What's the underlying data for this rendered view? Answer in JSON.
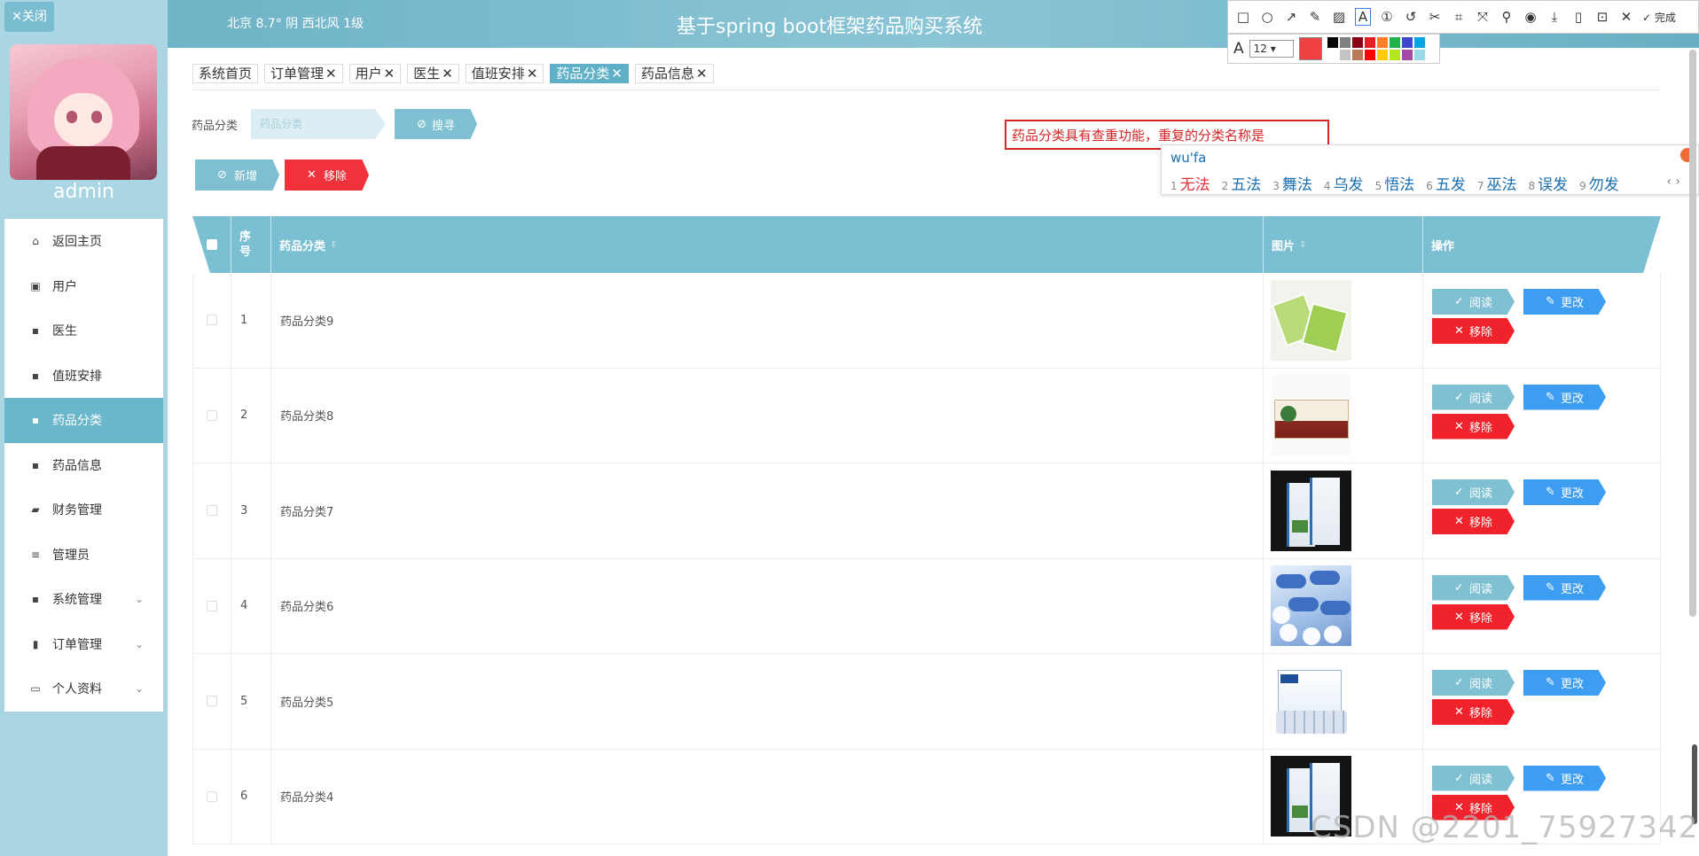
{
  "sidebar": {
    "close_label": "✕关闭",
    "username": "admin",
    "menu": [
      {
        "label": "返回主页",
        "icon": "home-icon",
        "glyph": "⌂",
        "active": false,
        "expandable": false
      },
      {
        "label": "用户",
        "icon": "user-icon",
        "glyph": "▣",
        "active": false,
        "expandable": false
      },
      {
        "label": "医生",
        "icon": "grid-icon",
        "glyph": "▪",
        "active": false,
        "expandable": false
      },
      {
        "label": "值班安排",
        "icon": "grid-icon",
        "glyph": "▪",
        "active": false,
        "expandable": false
      },
      {
        "label": "药品分类",
        "icon": "grid-icon",
        "glyph": "▪",
        "active": true,
        "expandable": false
      },
      {
        "label": "药品信息",
        "icon": "grid-icon",
        "glyph": "▪",
        "active": false,
        "expandable": false
      },
      {
        "label": "财务管理",
        "icon": "wallet-icon",
        "glyph": "▰",
        "active": false,
        "expandable": false
      },
      {
        "label": "管理员",
        "icon": "list-icon",
        "glyph": "≡",
        "active": false,
        "expandable": false
      },
      {
        "label": "系统管理",
        "icon": "grid-icon",
        "glyph": "▪",
        "active": false,
        "expandable": true
      },
      {
        "label": "订单管理",
        "icon": "chart-icon",
        "glyph": "▮",
        "active": false,
        "expandable": true
      },
      {
        "label": "个人资料",
        "icon": "card-icon",
        "glyph": "▭",
        "active": false,
        "expandable": true
      }
    ]
  },
  "header": {
    "weather": "北京  8.7°  阴  西北风  1级",
    "title": "基于spring boot框架药品购买系统"
  },
  "screenshot_tool": {
    "done_label": "完成",
    "font_size": "12",
    "selected_color": "#f04040",
    "palette": [
      "#000000",
      "#7f7f7f",
      "#880015",
      "#ed1c24",
      "#ff7f27",
      "#22b14c",
      "#3f48cc",
      "#00a2e8",
      "#ffffff",
      "#c3c3c3",
      "#b97a57",
      "#ff0000",
      "#ffc90e",
      "#b5e61d",
      "#a349a4",
      "#99d9ea"
    ]
  },
  "tabs": [
    {
      "label": "系统首页",
      "closable": false,
      "active": false
    },
    {
      "label": "订单管理",
      "closable": true,
      "active": false
    },
    {
      "label": "用户",
      "closable": true,
      "active": false
    },
    {
      "label": "医生",
      "closable": true,
      "active": false
    },
    {
      "label": "值班安排",
      "closable": true,
      "active": false
    },
    {
      "label": "药品分类",
      "closable": true,
      "active": true
    },
    {
      "label": "药品信息",
      "closable": true,
      "active": false
    }
  ],
  "search": {
    "label": "药品分类",
    "placeholder": "药品分类",
    "button_label": "搜寻"
  },
  "actions": {
    "add_label": "新增",
    "delete_label": "移除"
  },
  "annotation": {
    "text": "药品分类具有查重功能，重复的分类名称是"
  },
  "ime": {
    "input": "wu'fa",
    "candidates": [
      "无法",
      "五法",
      "舞法",
      "乌发",
      "悟法",
      "五发",
      "巫法",
      "误发",
      "勿发"
    ]
  },
  "table": {
    "headers": {
      "index": "序号",
      "category": "药品分类",
      "image": "图片",
      "ops": "操作"
    },
    "row_actions": {
      "view": "阅读",
      "edit": "更改",
      "delete": "移除"
    },
    "rows": [
      {
        "index": "1",
        "category": "药品分类9",
        "thumb": "green"
      },
      {
        "index": "2",
        "category": "药品分类8",
        "thumb": "red"
      },
      {
        "index": "3",
        "category": "药品分类7",
        "thumb": "dark"
      },
      {
        "index": "4",
        "category": "药品分类6",
        "thumb": "blue"
      },
      {
        "index": "5",
        "category": "药品分类5",
        "thumb": "box"
      },
      {
        "index": "6",
        "category": "药品分类4",
        "thumb": "dark"
      }
    ]
  },
  "watermark": "CSDN @2201_75927342"
}
